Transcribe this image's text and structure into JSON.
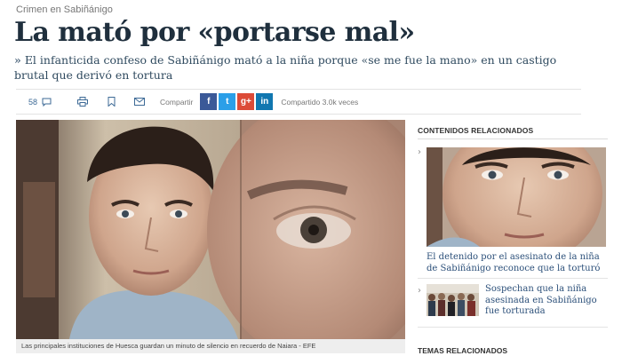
{
  "article": {
    "section": "Crimen en Sabiñánigo",
    "headline": "La mató por «portarse mal»",
    "subhead": "El infanticida confeso de Sabiñánigo mató a la niña porque «se me fue la mano» en un castigo brutal que derivó en tortura"
  },
  "toolbar": {
    "comment_count": "58",
    "share_label": "Compartir",
    "shared_text": "Compartido 3.0k veces",
    "social": [
      "f",
      "t",
      "g+",
      "in"
    ]
  },
  "photo": {
    "caption": "Las principales instituciones de Huesca guardan un minuto de silencio en recuerdo de Naiara - EFE"
  },
  "aside": {
    "related_title": "CONTENIDOS RELACIONADOS",
    "related": [
      {
        "text": "El detenido por el asesinato de la niña de Sabiñánigo reconoce que la torturó"
      },
      {
        "text": "Sospechan que la niña asesinada en Sabiñánigo fue torturada"
      }
    ],
    "topics_title": "TEMAS RELACIONADOS"
  }
}
